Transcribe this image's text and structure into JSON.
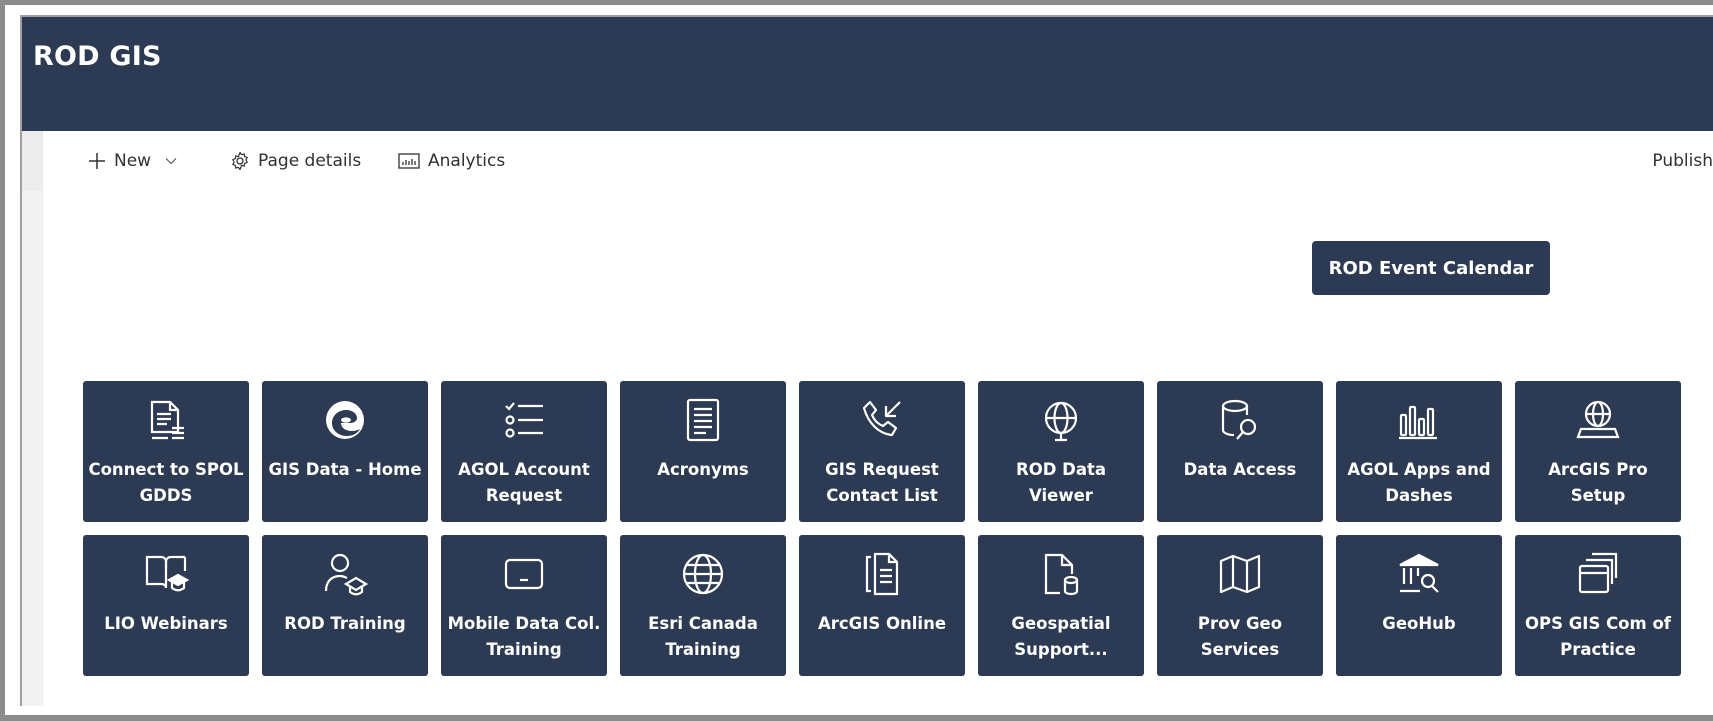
{
  "site": {
    "title": "ROD GIS"
  },
  "command_bar": {
    "new_label": "New",
    "page_details_label": "Page details",
    "analytics_label": "Analytics",
    "publish_label": "Publish"
  },
  "event_button": {
    "label": "ROD Event Calendar"
  },
  "tiles_row1": [
    {
      "label": "Connect to SPOL GDDS",
      "icon": "document-list-icon"
    },
    {
      "label": "GIS Data - Home",
      "icon": "edge-browser-icon"
    },
    {
      "label": "AGOL Account Request",
      "icon": "task-list-icon"
    },
    {
      "label": "Acronyms",
      "icon": "text-document-icon"
    },
    {
      "label": "GIS Request Contact List",
      "icon": "phone-incoming-icon"
    },
    {
      "label": "ROD Data Viewer",
      "icon": "globe-pointer-icon"
    },
    {
      "label": "Data Access",
      "icon": "database-search-icon"
    },
    {
      "label": "AGOL Apps and Dashes",
      "icon": "bar-chart-icon"
    },
    {
      "label": "ArcGIS Pro Setup",
      "icon": "globe-desktop-icon"
    }
  ],
  "tiles_row2": [
    {
      "label": "LIO Webinars",
      "icon": "book-education-icon"
    },
    {
      "label": "ROD Training",
      "icon": "person-education-icon"
    },
    {
      "label": "Mobile Data Col. Training",
      "icon": "tablet-icon"
    },
    {
      "label": "Esri Canada Training",
      "icon": "globe-icon"
    },
    {
      "label": "ArcGIS Online",
      "icon": "documents-icon"
    },
    {
      "label": "Geospatial Support...",
      "icon": "document-database-icon"
    },
    {
      "label": "Prov Geo Services",
      "icon": "map-icon"
    },
    {
      "label": "GeoHub",
      "icon": "building-search-icon"
    },
    {
      "label": "OPS GIS Com of Practice",
      "icon": "stacked-windows-icon"
    }
  ],
  "colors": {
    "header_bg": "#2d3a54",
    "tile_bg": "#2d3a54",
    "tile_text": "#ffffff"
  }
}
